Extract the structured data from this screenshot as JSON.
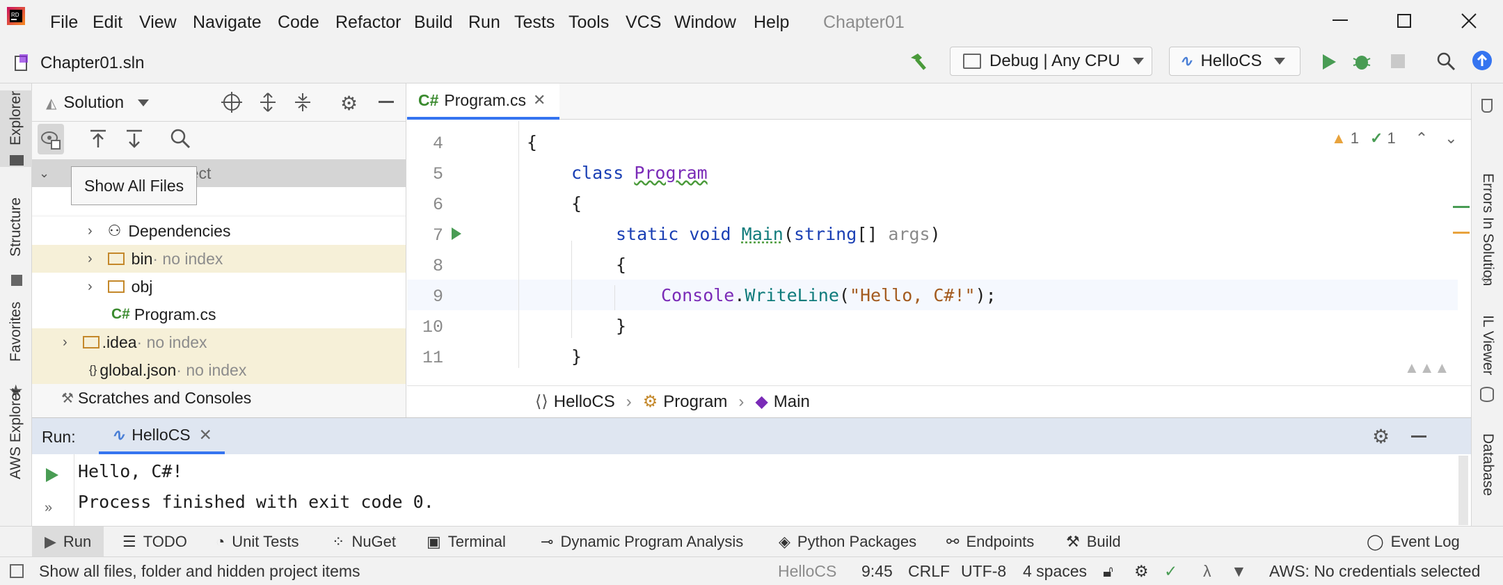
{
  "app": {
    "title": "Chapter01",
    "solution_file": "Chapter01.sln"
  },
  "menu": [
    "File",
    "Edit",
    "View",
    "Navigate",
    "Code",
    "Refactor",
    "Build",
    "Run",
    "Tests",
    "Tools",
    "VCS",
    "Window",
    "Help"
  ],
  "toolbar": {
    "config": "Debug | Any CPU",
    "run_config": "HelloCS"
  },
  "left_tabs": [
    "Explorer",
    "Structure",
    "Favorites",
    "AWS Explorer"
  ],
  "right_tabs": [
    "Errors In Solution",
    "IL Viewer",
    "Database"
  ],
  "explorer": {
    "view_selector": "Solution",
    "tooltip": "Show All Files",
    "root_partial": "roject",
    "items": [
      {
        "label": "Dependencies",
        "suffix": ""
      },
      {
        "label": "bin",
        "suffix": " · no index"
      },
      {
        "label": "obj",
        "suffix": ""
      },
      {
        "label": "Program.cs",
        "suffix": ""
      },
      {
        "label": ".idea",
        "suffix": " · no index"
      },
      {
        "label": "global.json",
        "suffix": " · no index"
      },
      {
        "label": "Scratches and Consoles",
        "suffix": ""
      }
    ]
  },
  "editor": {
    "tab": "Program.cs",
    "tab_lang": "C#",
    "warnings": "1",
    "ok": "1",
    "lines": [
      "4",
      "5",
      "6",
      "7",
      "8",
      "9",
      "10",
      "11"
    ],
    "code": {
      "l4": "{",
      "l5_kw": "class",
      "l5_ty": "Program",
      "l6": "{",
      "l7_kw1": "static",
      "l7_kw2": "void",
      "l7_mt": "Main",
      "l7_p1": "(",
      "l7_ty": "string",
      "l7_p2": "[] ",
      "l7_arg": "args",
      "l7_p3": ")",
      "l8": "{",
      "l9_ty": "Console",
      "l9_dot": ".",
      "l9_mt": "WriteLine",
      "l9_p1": "(",
      "l9_str": "\"Hello, C#!\"",
      "l9_p2": ");",
      "l10": "}",
      "l11": "}"
    },
    "breadcrumb": [
      "HelloCS",
      "Program",
      "Main"
    ]
  },
  "run": {
    "label": "Run:",
    "tab": "HelloCS",
    "output": [
      "Hello, C#!",
      "Process finished with exit code 0."
    ]
  },
  "bottom_tools": [
    "Run",
    "TODO",
    "Unit Tests",
    "NuGet",
    "Terminal",
    "Dynamic Program Analysis",
    "Python Packages",
    "Endpoints",
    "Build",
    "Event Log"
  ],
  "status": {
    "message": "Show all files, folder and hidden project items",
    "project": "HelloCS",
    "position": "9:45",
    "line_sep": "CRLF",
    "encoding": "UTF-8",
    "indent": "4 spaces",
    "aws": "AWS: No credentials selected"
  },
  "colors": {
    "accent": "#3574f0",
    "run_green": "#499c54",
    "warning": "#e8a33d",
    "noindex_bg": "#f6f0d8"
  }
}
